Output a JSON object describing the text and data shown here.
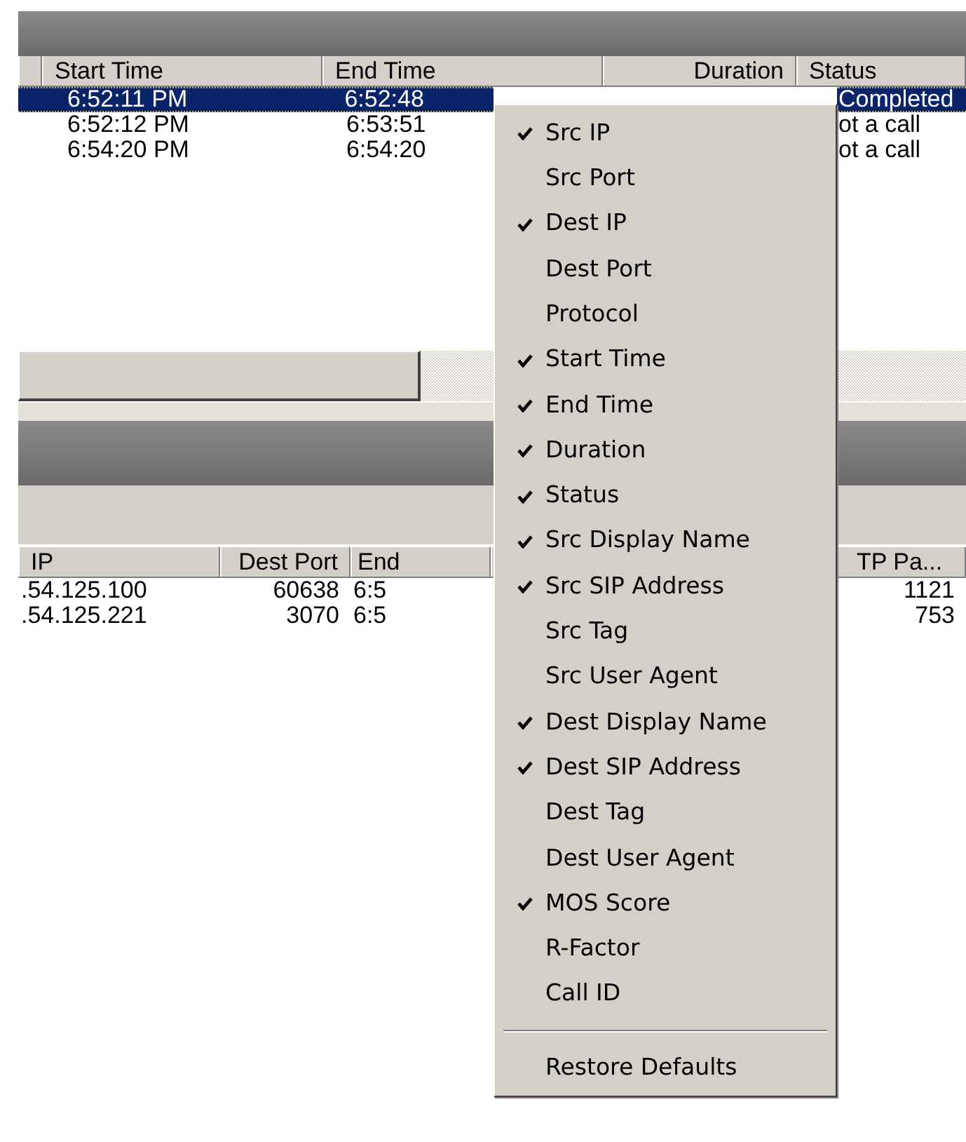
{
  "calls_table": {
    "columns": [
      "Start Time",
      "End Time",
      "Duration",
      "Status"
    ],
    "rows": [
      {
        "selected": true,
        "start_time": "6:52:11 PM",
        "end_time": "6:52:48",
        "status": "Completed"
      },
      {
        "selected": false,
        "start_time": "6:52:12 PM",
        "end_time": "6:53:51",
        "status": "ot a call"
      },
      {
        "selected": false,
        "start_time": "6:54:20 PM",
        "end_time": "6:54:20",
        "status": "ot a call"
      }
    ]
  },
  "streams_table": {
    "columns": [
      "IP",
      "Dest Port",
      "End",
      "TP Pa..."
    ],
    "rows": [
      {
        "ip": ".54.125.100",
        "dest_port": "60638",
        "end": "6:5",
        "column_4": "1121"
      },
      {
        "ip": ".54.125.221",
        "dest_port": "3070",
        "end": "6:5",
        "column_4": "753"
      }
    ]
  },
  "column_menu": {
    "items": [
      {
        "kind": "toggle",
        "label": "Src IP",
        "checked": true
      },
      {
        "kind": "toggle",
        "label": "Src Port",
        "checked": false
      },
      {
        "kind": "toggle",
        "label": "Dest IP",
        "checked": true
      },
      {
        "kind": "toggle",
        "label": "Dest Port",
        "checked": false
      },
      {
        "kind": "toggle",
        "label": "Protocol",
        "checked": false
      },
      {
        "kind": "toggle",
        "label": "Start Time",
        "checked": true
      },
      {
        "kind": "toggle",
        "label": "End Time",
        "checked": true
      },
      {
        "kind": "toggle",
        "label": "Duration",
        "checked": true
      },
      {
        "kind": "toggle",
        "label": "Status",
        "checked": true
      },
      {
        "kind": "toggle",
        "label": "Src Display Name",
        "checked": true
      },
      {
        "kind": "toggle",
        "label": "Src SIP Address",
        "checked": true
      },
      {
        "kind": "toggle",
        "label": "Src Tag",
        "checked": false
      },
      {
        "kind": "toggle",
        "label": "Src User Agent",
        "checked": false
      },
      {
        "kind": "toggle",
        "label": "Dest Display Name",
        "checked": true
      },
      {
        "kind": "toggle",
        "label": "Dest SIP Address",
        "checked": true
      },
      {
        "kind": "toggle",
        "label": "Dest Tag",
        "checked": false
      },
      {
        "kind": "toggle",
        "label": "Dest User Agent",
        "checked": false
      },
      {
        "kind": "toggle",
        "label": "MOS Score",
        "checked": true
      },
      {
        "kind": "toggle",
        "label": "R-Factor",
        "checked": false
      },
      {
        "kind": "toggle",
        "label": "Call ID",
        "checked": false
      },
      {
        "kind": "separator"
      },
      {
        "kind": "command",
        "label": "Restore Defaults"
      }
    ]
  }
}
